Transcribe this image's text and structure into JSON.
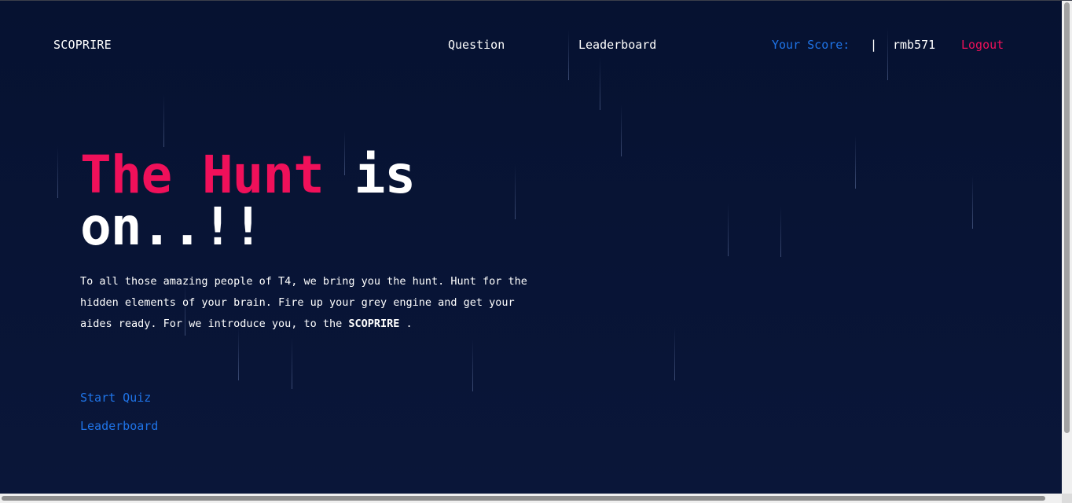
{
  "header": {
    "brand": "SCOPRIRE",
    "nav": {
      "question": "Question",
      "leaderboard": "Leaderboard"
    },
    "score_label": "Your Score:",
    "separator": "|",
    "username": "rmb571",
    "logout": "Logout"
  },
  "hero": {
    "title_highlight": "The Hunt",
    "title_rest": " is on..!!"
  },
  "intro": {
    "text": "To all those amazing people of T4, we bring you the hunt. Hunt for the hidden elements of your brain. Fire up your grey engine and get your aides ready. For we introduce you, to the ",
    "brand": "SCOPRIRE",
    "end": " ."
  },
  "links": {
    "start_quiz": "Start Quiz",
    "leaderboard": "Leaderboard"
  },
  "colors": {
    "background": "#071433",
    "accent_pink": "#f0105a",
    "accent_blue": "#1f74e8",
    "text": "#ffffff"
  },
  "icons": {
    "background_effect": "falling-rain-lines"
  }
}
